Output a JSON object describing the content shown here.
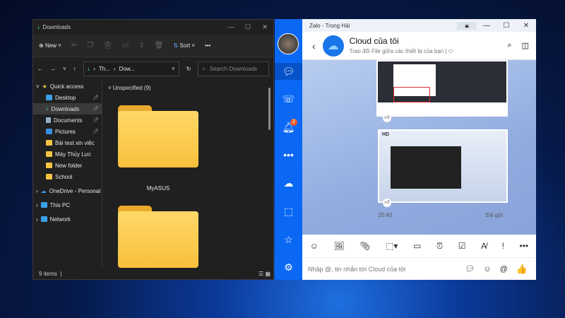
{
  "explorer": {
    "title": "Downloads",
    "new_label": "New",
    "sort_label": "Sort",
    "more": "•••",
    "breadcrumb": [
      "Th...",
      "Dow..."
    ],
    "search_placeholder": "Search Downloads",
    "group_header": "Unspecified (9)",
    "nav": [
      {
        "label": "Quick access"
      },
      {
        "label": "Desktop",
        "pinned": true
      },
      {
        "label": "Downloads",
        "pinned": true,
        "selected": true
      },
      {
        "label": "Documents",
        "pinned": true
      },
      {
        "label": "Pictures",
        "pinned": true
      },
      {
        "label": "Bài test xin việc"
      },
      {
        "label": "Máy Thủy Lực"
      },
      {
        "label": "New folder"
      },
      {
        "label": "School"
      },
      {
        "label": "OneDrive - Personal"
      },
      {
        "label": "This PC"
      },
      {
        "label": "Network"
      }
    ],
    "folders": [
      {
        "label": "MyASUS"
      },
      {
        "label": ""
      }
    ],
    "status": "9 items"
  },
  "zalo": {
    "window_title": "Zalo - Trọng Hải",
    "chat_title": "Cloud của tôi",
    "chat_subtitle": "Trao đổi File giữa các thiết bị của bạn",
    "notification_badge": "2",
    "image_badge": "HD",
    "time": "20:40",
    "sent_status": "Đã gửi",
    "input_placeholder": "Nhập @, tin nhắn tới Cloud của tôi"
  },
  "colors": {
    "zalo_blue": "#0a68f5",
    "explorer_bg": "#202020"
  }
}
